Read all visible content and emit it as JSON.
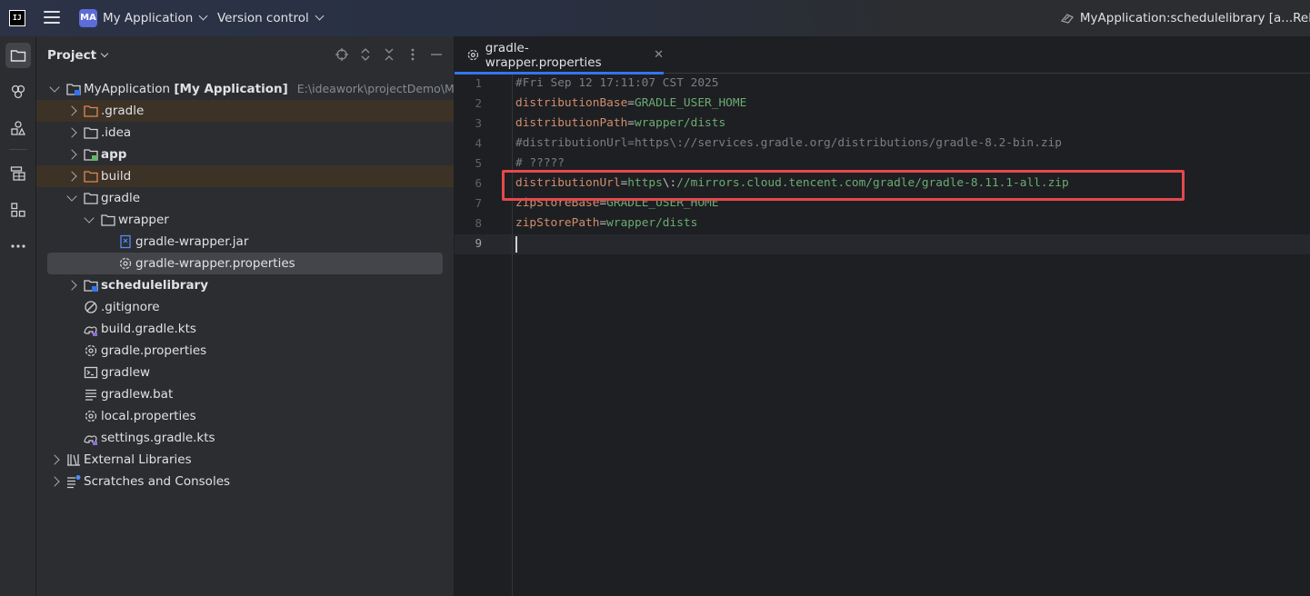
{
  "titlebar": {
    "logo_text": "IJ",
    "project_badge": "MA",
    "project_name": "My Application",
    "version_control": "Version control",
    "run_config": "MyApplication:schedulelibrary [a...Rel"
  },
  "project_panel": {
    "title": "Project",
    "tree": [
      {
        "label": "MyApplication",
        "suffix": "[My Application]",
        "path": "E:\\ideawork\\projectDemo\\MyApp",
        "icon": "module-folder-icon",
        "expanded": true
      },
      {
        "label": ".gradle",
        "icon": "folder-icon",
        "expanded": false,
        "excluded": true
      },
      {
        "label": ".idea",
        "icon": "folder-icon",
        "expanded": false
      },
      {
        "label": "app",
        "icon": "module-folder-icon",
        "expanded": false
      },
      {
        "label": "build",
        "icon": "folder-icon",
        "expanded": false,
        "excluded": true
      },
      {
        "label": "gradle",
        "icon": "folder-icon",
        "expanded": true
      },
      {
        "label": "wrapper",
        "icon": "folder-icon",
        "expanded": true
      },
      {
        "label": "gradle-wrapper.jar",
        "icon": "jar-icon"
      },
      {
        "label": "gradle-wrapper.properties",
        "icon": "settings-file-icon",
        "selected": true
      },
      {
        "label": "schedulelibrary",
        "icon": "module-folder-icon",
        "expanded": false
      },
      {
        "label": ".gitignore",
        "icon": "ignore-file-icon"
      },
      {
        "label": "build.gradle.kts",
        "icon": "gradle-kts-icon"
      },
      {
        "label": "gradle.properties",
        "icon": "settings-file-icon"
      },
      {
        "label": "gradlew",
        "icon": "terminal-file-icon"
      },
      {
        "label": "gradlew.bat",
        "icon": "text-file-icon"
      },
      {
        "label": "local.properties",
        "icon": "settings-file-icon"
      },
      {
        "label": "settings.gradle.kts",
        "icon": "gradle-kts-icon"
      },
      {
        "label": "External Libraries",
        "icon": "library-icon",
        "expanded": false
      },
      {
        "label": "Scratches and Consoles",
        "icon": "scratches-icon",
        "expanded": false
      }
    ]
  },
  "editor": {
    "tab_label": "gradle-wrapper.properties",
    "line_numbers": [
      "1",
      "2",
      "3",
      "4",
      "5",
      "6",
      "7",
      "8",
      "9"
    ],
    "lines": [
      {
        "comment": "#Fri Sep 12 17:11:07 CST 2025"
      },
      {
        "key": "distributionBase",
        "eq": "=",
        "val": "GRADLE_USER_HOME"
      },
      {
        "key": "distributionPath",
        "eq": "=",
        "val": "wrapper/dists"
      },
      {
        "comment": "#distributionUrl=https\\://services.gradle.org/distributions/gradle-8.2-bin.zip"
      },
      {
        "comment": "# ?????"
      },
      {
        "key": "distributionUrl",
        "eq": "=",
        "val_a": "https",
        "esc": "\\:",
        "val_b": "//mirrors.cloud.tencent.com/gradle/gradle-8.11.1-all.zip"
      },
      {
        "key": "zipStoreBase",
        "eq": "=",
        "val": "GRADLE_USER_HOME"
      },
      {
        "key": "zipStorePath",
        "eq": "=",
        "val": "wrapper/dists"
      },
      {
        "text": ""
      }
    ]
  },
  "colors": {
    "accent": "#3574f0",
    "highlight_box": "#e5484d",
    "property_key": "#cf8e6d",
    "property_value": "#6aab73",
    "comment": "#7a7e85"
  }
}
